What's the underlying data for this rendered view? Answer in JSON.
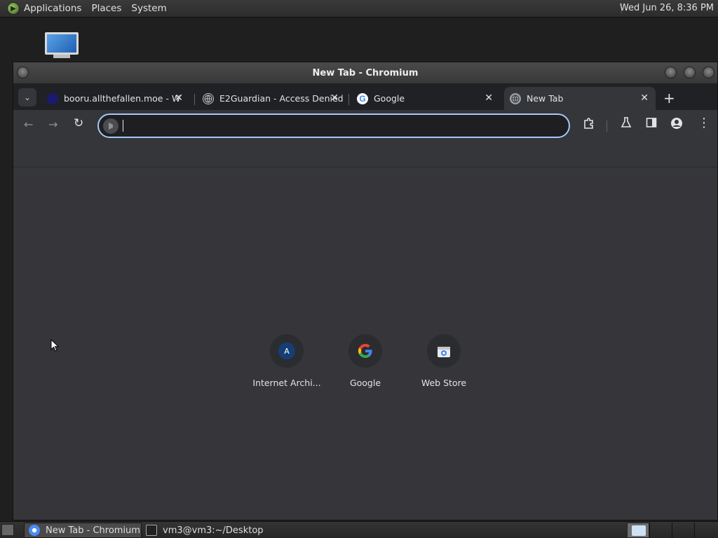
{
  "top_panel": {
    "menus": [
      "Applications",
      "Places",
      "System"
    ],
    "clock": "Wed Jun 26,  8:36 PM"
  },
  "window": {
    "title": "New Tab - Chromium"
  },
  "tabs": [
    {
      "label": "booru.allthefallen.moe - W",
      "favicon": "booru-icon",
      "active": false
    },
    {
      "label": "E2Guardian - Access Denied",
      "favicon": "globe-icon",
      "active": false
    },
    {
      "label": "Google",
      "favicon": "google-icon",
      "active": false
    },
    {
      "label": "New Tab",
      "favicon": "globe-icon",
      "active": true
    }
  ],
  "omnibox": {
    "value": "",
    "placeholder": ""
  },
  "shortcuts": [
    {
      "label": "Internet Archi...",
      "icon": "internet-archive-icon",
      "letter": "A"
    },
    {
      "label": "Google",
      "icon": "google-icon"
    },
    {
      "label": "Web Store",
      "icon": "web-store-icon"
    }
  ],
  "taskbar": {
    "tasks": [
      {
        "label": "New Tab - Chromium",
        "active": true
      },
      {
        "label": "vm3@vm3:~/Desktop",
        "active": false
      }
    ]
  },
  "colors": {
    "accent": "#a8c7fa",
    "ntp_background": "#36363a",
    "tabstrip": "#202124"
  }
}
